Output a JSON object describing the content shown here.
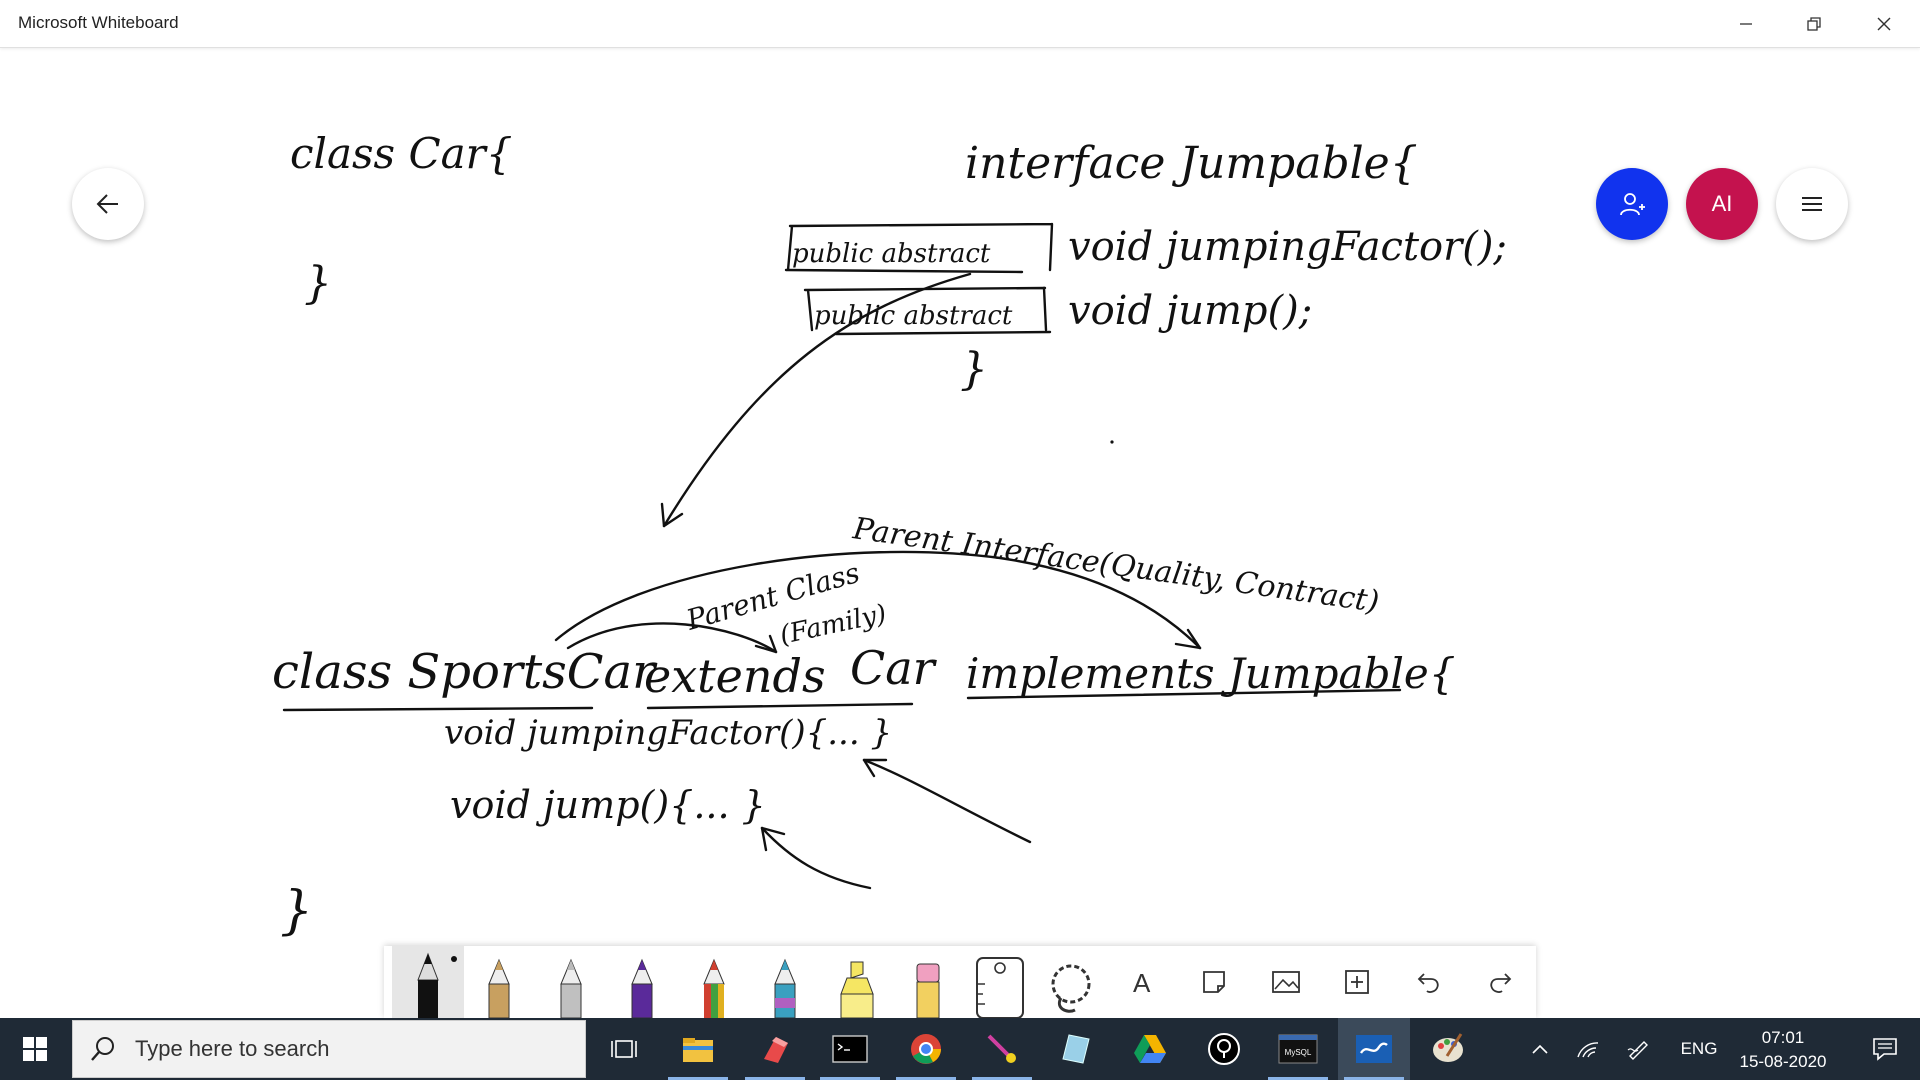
{
  "window": {
    "title": "Microsoft Whiteboard",
    "controls": [
      "minimize",
      "restore",
      "close"
    ]
  },
  "canvas_buttons": {
    "back_icon": "arrow-left-icon",
    "invite_icon": "add-person-icon",
    "avatar_initials": "AI",
    "menu_icon": "hamburger-menu-icon",
    "invite_color": "#1133ee",
    "avatar_color": "#c4124e"
  },
  "handwriting": {
    "class_car": "class Car{",
    "class_car_close": "}",
    "interface_header": "interface Jumpable{",
    "public_abstract_1": "public abstract",
    "method_1": "void jumpingFactor();",
    "public_abstract_2": "public abstract",
    "method_2": "void jump();",
    "interface_close": "}",
    "parent_interface_note": "Parent Interface(Quality, Contract)",
    "parent_class_note": "Parent Class",
    "family_note": "(Family)",
    "class_sportscar": "class SportsCar",
    "extends_kw": "extends",
    "car_kw": "Car",
    "implements_kw": "implements Jumpable{",
    "impl_method_1": "void jumpingFactor(){...  }",
    "impl_method_2": "void jump(){...   }",
    "sportscar_close": "}"
  },
  "toolbar": {
    "tools": [
      {
        "name": "pen-black",
        "color": "#111111",
        "selected": true
      },
      {
        "name": "pen-gold",
        "color": "#c8a060"
      },
      {
        "name": "pen-silver",
        "color": "#c0c0c0"
      },
      {
        "name": "pen-purple",
        "color": "#5a2a9a"
      },
      {
        "name": "pen-rainbow",
        "color": "#d04030"
      },
      {
        "name": "pen-galaxy",
        "color": "#3aa0c0"
      },
      {
        "name": "highlighter-yellow",
        "color": "#f5e663"
      },
      {
        "name": "eraser",
        "color": "#f0a0c0"
      },
      {
        "name": "ruler-icon"
      },
      {
        "name": "lasso-icon"
      },
      {
        "name": "text-icon",
        "label": "A"
      },
      {
        "name": "note-icon"
      },
      {
        "name": "image-icon"
      },
      {
        "name": "insert-icon"
      },
      {
        "name": "undo-icon"
      },
      {
        "name": "redo-icon"
      }
    ]
  },
  "taskbar": {
    "search_placeholder": "Type here to search",
    "apps": [
      "task-view-icon",
      "file-explorer-icon",
      "paint-3d-icon",
      "terminal-icon",
      "chrome-icon",
      "snipping-icon",
      "notepad-icon",
      "google-drive-icon",
      "light-bulb-icon",
      "mysql-icon",
      "whiteboard-icon",
      "paint-icon"
    ],
    "mysql_label": "MySQL",
    "language": "ENG",
    "time": "07:01",
    "date": "15-08-2020"
  }
}
